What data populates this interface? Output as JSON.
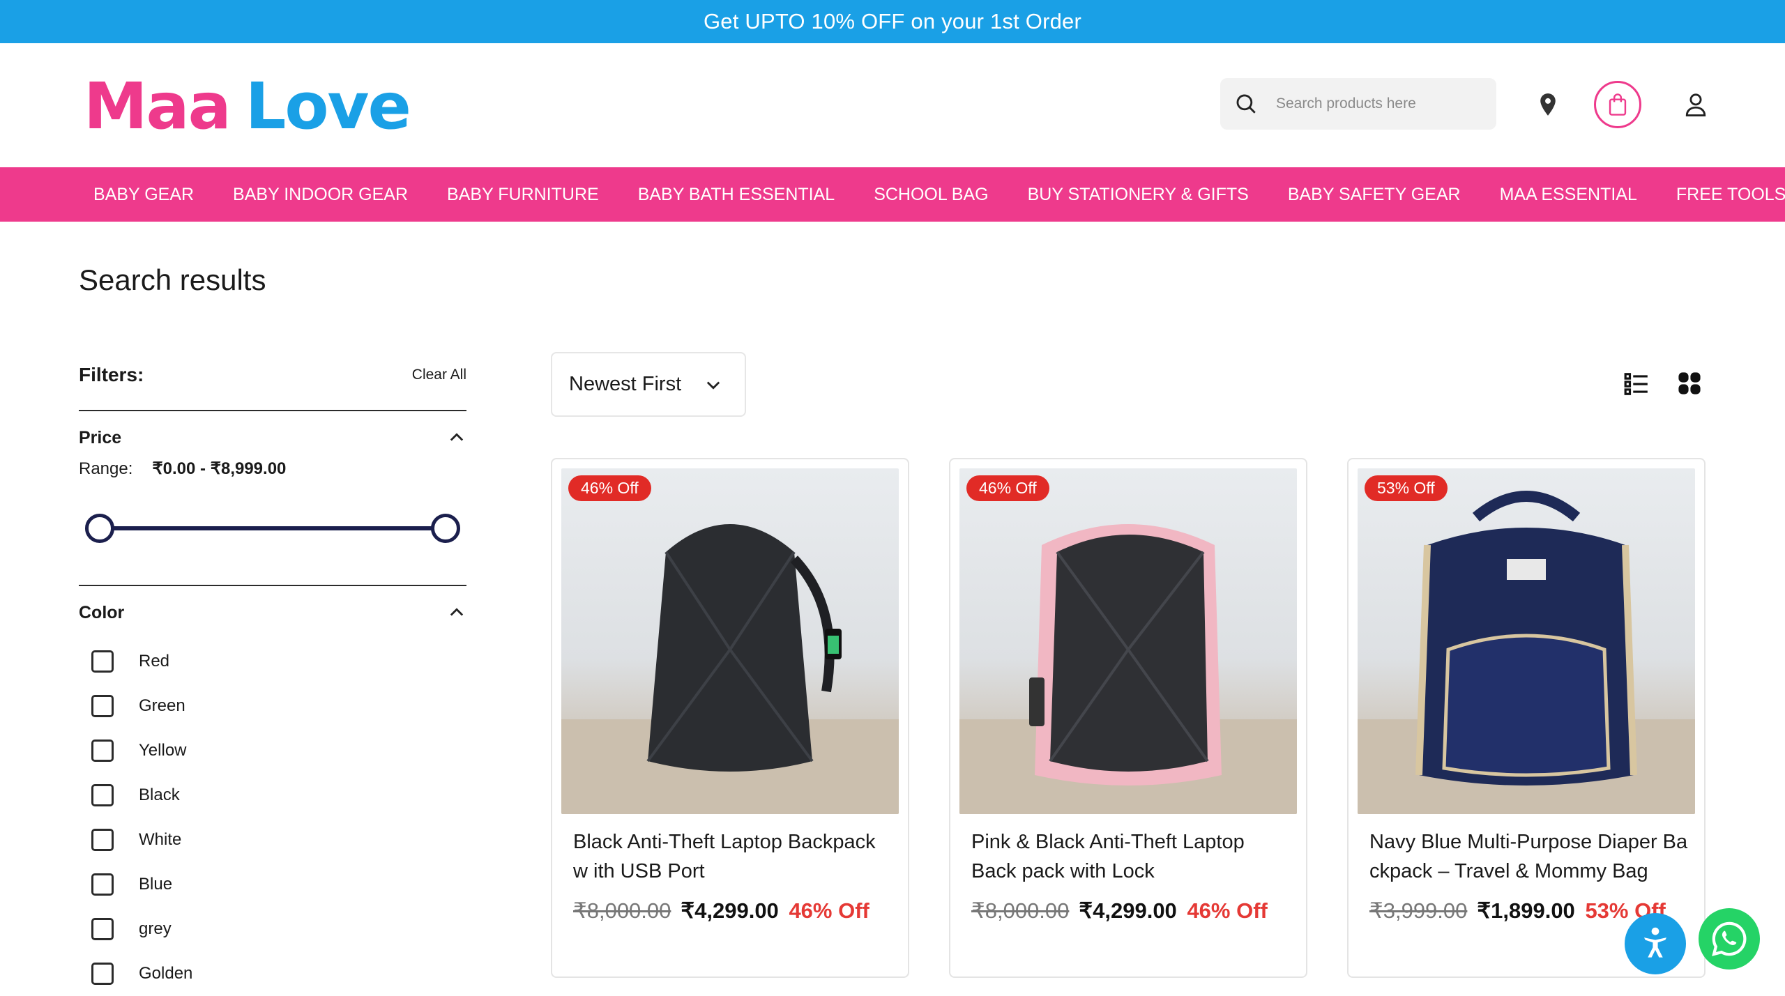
{
  "announcement": "Get UPTO 10% OFF on your 1st Order",
  "header": {
    "logo_part1": "Maa",
    "logo_part2": "Love",
    "search_placeholder": "Search products here"
  },
  "nav": [
    "BABY GEAR",
    "BABY INDOOR GEAR",
    "BABY FURNITURE",
    "BABY BATH ESSENTIAL",
    "SCHOOL BAG",
    "BUY STATIONERY & GIFTS",
    "BABY SAFETY GEAR",
    "MAA ESSENTIAL",
    "FREE TOOLS"
  ],
  "page_title": "Search results",
  "filters": {
    "title": "Filters:",
    "clear_all": "Clear All",
    "price": {
      "title": "Price",
      "range_label": "Range:",
      "range_value": "₹0.00 - ₹8,999.00"
    },
    "color": {
      "title": "Color",
      "options": [
        "Red",
        "Green",
        "Yellow",
        "Black",
        "White",
        "Blue",
        "grey",
        "Golden"
      ]
    }
  },
  "sort": {
    "selected": "Newest First"
  },
  "products": [
    {
      "badge": "46% Off",
      "name": "Black Anti-Theft Laptop Backpack w ith USB Port",
      "old_price": "₹8,000.00",
      "price": "₹4,299.00",
      "discount": "46% Off",
      "bag_color": "#2b2d31",
      "accent_color": "#2b2d31"
    },
    {
      "badge": "46% Off",
      "name": "Pink & Black Anti-Theft Laptop Back pack with Lock",
      "old_price": "₹8,000.00",
      "price": "₹4,299.00",
      "discount": "46% Off",
      "bag_color": "#2f3034",
      "accent_color": "#f1b7c3"
    },
    {
      "badge": "53% Off",
      "name": "Navy Blue Multi-Purpose Diaper Ba ckpack – Travel & Mommy Bag",
      "old_price": "₹3,999.00",
      "price": "₹1,899.00",
      "discount": "53% Off",
      "bag_color": "#1e2a57",
      "accent_color": "#d8c6a0"
    }
  ],
  "colors": {
    "announcement_bg": "#1aa0e6",
    "nav_bg": "#ee3a8c",
    "discount_red": "#e12b26",
    "slider": "#1b1f4d",
    "whatsapp": "#25d366"
  }
}
